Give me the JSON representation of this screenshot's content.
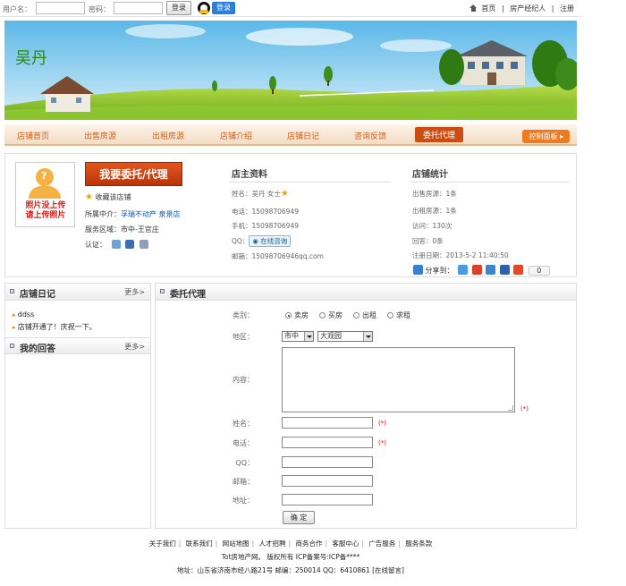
{
  "topbar": {
    "username_label": "用户名：",
    "password_label": "密码：",
    "login_button": "登录",
    "qq_login": "登录",
    "home": "首页",
    "agent": "房产经纪人",
    "register": "注册",
    "sep": "|"
  },
  "banner": {
    "owner_name": "吴丹"
  },
  "nav": {
    "items": [
      "店铺首页",
      "出售房源",
      "出租房源",
      "店铺介绍",
      "店铺日记",
      "咨询反馈",
      "委托代理"
    ],
    "active_index": 6,
    "control_panel": "控制面板 ▸"
  },
  "profile": {
    "photo_text_1": "照片没上传",
    "photo_text_2": "请上传照片",
    "entrust_button": "我要委托/代理",
    "favorite": "收藏该店铺",
    "agency_label": "所属中介：",
    "agency_value": "孚瑞不动产 泉景店",
    "area_label": "服务区域：",
    "area_value": "市中-王官庄",
    "cert_label": "认证："
  },
  "owner_info": {
    "title": "店主资料",
    "name_label": "姓名：",
    "name_value": "吴丹 女士",
    "phone_label": "电话：",
    "phone_value": "15098706949",
    "mobile_label": "手机：",
    "mobile_value": "15098706949",
    "qq_label": "QQ：",
    "qq_button": "在线咨询",
    "email_label": "邮箱：",
    "email_value": "15098706946qq.com"
  },
  "stats": {
    "title": "店铺统计",
    "sale": "出售房源：1条",
    "rent": "出租房源：1条",
    "visits": "访问：130次",
    "answers": "回答：0条",
    "reg_date": "注册日期：2013-5-2  11:40:50",
    "share_label": "分享到：",
    "share_count": "0"
  },
  "diary": {
    "title": "店铺日记",
    "more": "更多>",
    "items": [
      "ddss",
      "店铺开通了！庆祝一下。"
    ]
  },
  "answers": {
    "title": "我的回答",
    "more": "更多>"
  },
  "form": {
    "title": "委托代理",
    "type_label": "类别：",
    "types": [
      "卖房",
      "买房",
      "出租",
      "求租"
    ],
    "selected_type": 0,
    "region_label": "地区：",
    "district": "市中",
    "subregion": "大观园",
    "content_label": "内容：",
    "name_label": "姓名：",
    "phone_label": "电话：",
    "qq_label": "QQ：",
    "email_label": "邮箱：",
    "address_label": "地址：",
    "required_mark": "(*)",
    "submit": "确 定"
  },
  "footer": {
    "links": [
      "关于我们",
      "联系我们",
      "网站地图",
      "人才招聘",
      "商务合作",
      "客服中心",
      "广告服务",
      "服务条款"
    ],
    "copyright": "Tot房地产网。  版权所有 ICP备案号:ICP备****",
    "address": "地址：山东省济南市经八路21号 邮编：250014 QQ：6410861 [在线留言]"
  },
  "colors": {
    "accent": "#cc4d12",
    "nav_text": "#d0601a",
    "owner_name": "#2d8a07",
    "required": "#dd0000"
  }
}
